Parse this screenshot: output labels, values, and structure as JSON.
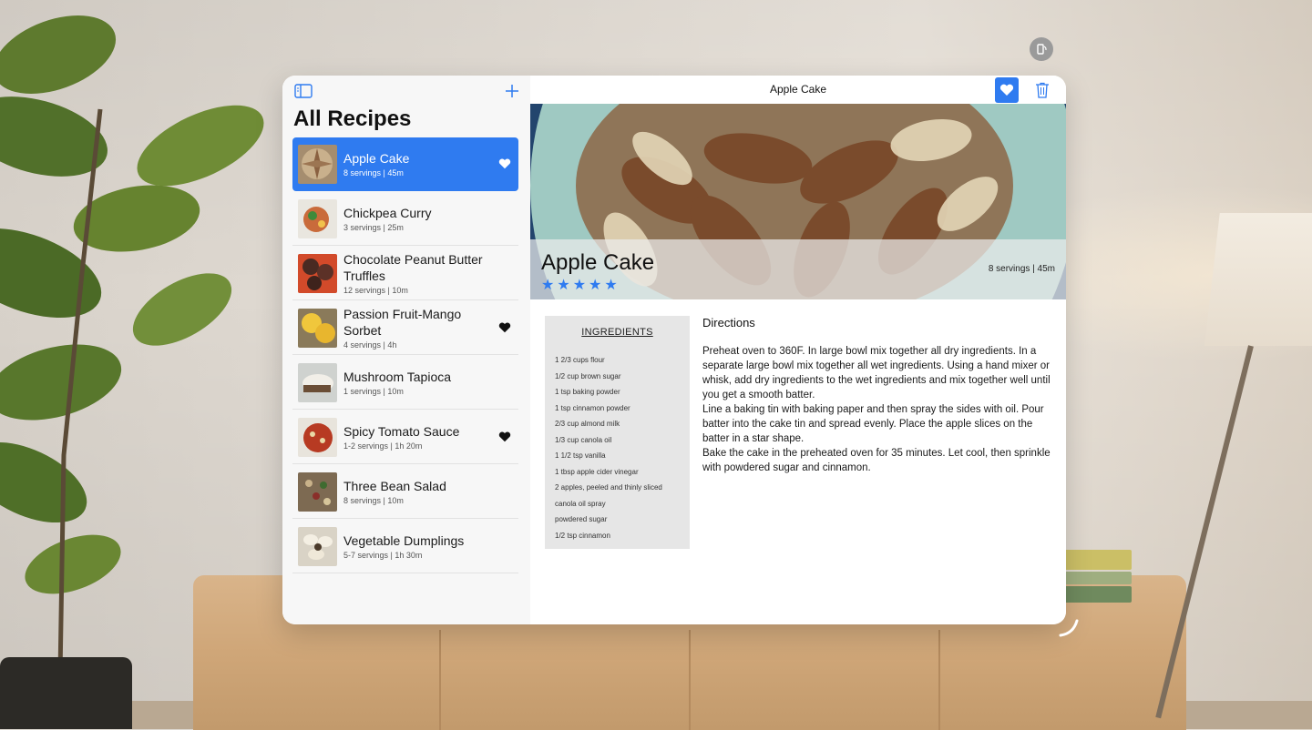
{
  "window": {
    "sidebar_title": "All Recipes",
    "toolbar_title": "Apple Cake"
  },
  "icons": {
    "sidebar_toggle": "sidebar-icon",
    "add": "plus-icon",
    "favorite": "heart-icon",
    "delete": "trash-icon",
    "rotate": "rotate-icon",
    "resize": "resize-handle-icon"
  },
  "colors": {
    "accent": "#2f7bf0",
    "ingredients_bg": "#e6e6e6"
  },
  "recipes": [
    {
      "name": "Apple Cake",
      "meta": "8 servings | 45m",
      "favorite": true,
      "selected": true
    },
    {
      "name": "Chickpea Curry",
      "meta": "3 servings | 25m",
      "favorite": false,
      "selected": false
    },
    {
      "name": "Chocolate Peanut Butter Truffles",
      "meta": "12 servings | 10m",
      "favorite": false,
      "selected": false
    },
    {
      "name": "Passion Fruit-Mango Sorbet",
      "meta": "4 servings | 4h",
      "favorite": true,
      "selected": false
    },
    {
      "name": "Mushroom Tapioca",
      "meta": "1 servings | 10m",
      "favorite": false,
      "selected": false
    },
    {
      "name": "Spicy Tomato Sauce",
      "meta": "1-2 servings | 1h 20m",
      "favorite": true,
      "selected": false
    },
    {
      "name": "Three Bean Salad",
      "meta": "8 servings | 10m",
      "favorite": false,
      "selected": false
    },
    {
      "name": "Vegetable Dumplings",
      "meta": "5-7 servings | 1h 30m",
      "favorite": false,
      "selected": false
    }
  ],
  "detail": {
    "title": "Apple Cake",
    "rating": "★★★★★",
    "rating_value": 5,
    "meta": "8 servings | 45m",
    "ingredients_title": "INGREDIENTS",
    "ingredients": [
      "1 2/3 cups flour",
      "1/2 cup brown sugar",
      "1 tsp baking powder",
      "1 tsp cinnamon powder",
      "2/3 cup almond milk",
      "1/3 cup canola oil",
      "1 1/2 tsp vanilla",
      "1 tbsp apple cider vinegar",
      "2 apples, peeled and thinly sliced",
      "canola oil spray",
      "powdered sugar",
      "1/2 tsp cinnamon"
    ],
    "directions_title": "Directions",
    "directions": "Preheat oven to 360F. In large bowl mix together all dry ingredients. In a separate large bowl mix together all wet ingredients. Using a hand mixer or whisk, add dry ingredients to the wet ingredients and mix together well until you get a smooth batter.\nLine a baking tin with baking paper and then spray the sides with oil. Pour batter into the cake tin and spread evenly. Place the apple slices on the batter in a star shape.\nBake the cake in the preheated oven for 35 minutes. Let cool, then sprinkle with powdered sugar and cinnamon."
  }
}
